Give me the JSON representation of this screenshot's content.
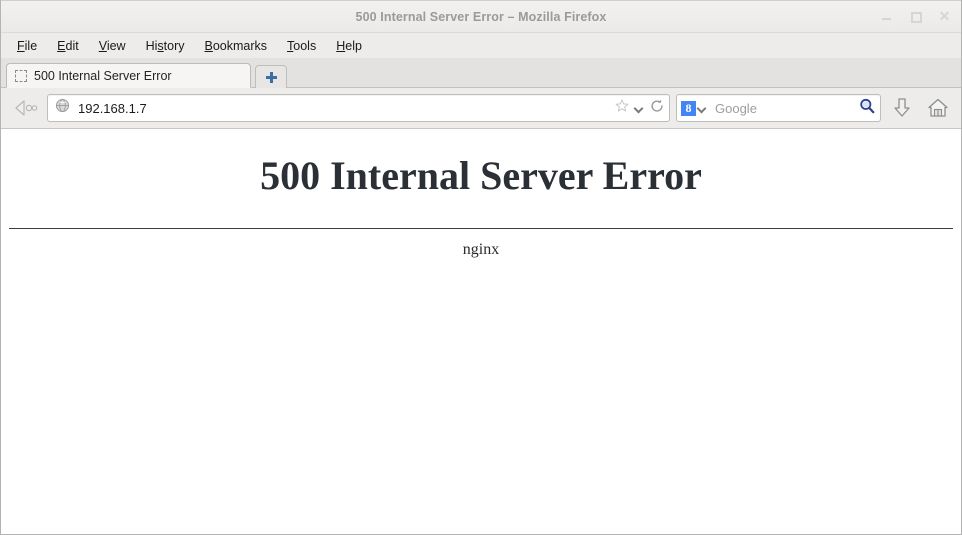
{
  "window": {
    "title": "500 Internal Server Error – Mozilla Firefox",
    "controls": {
      "minimize": "minimize",
      "maximize": "maximize",
      "close": "close"
    }
  },
  "menubar": {
    "items": [
      {
        "pre": "",
        "mnemonic": "F",
        "post": "ile"
      },
      {
        "pre": "",
        "mnemonic": "E",
        "post": "dit"
      },
      {
        "pre": "",
        "mnemonic": "V",
        "post": "iew"
      },
      {
        "pre": "Hi",
        "mnemonic": "s",
        "post": "tory"
      },
      {
        "pre": "",
        "mnemonic": "B",
        "post": "ookmarks"
      },
      {
        "pre": "",
        "mnemonic": "T",
        "post": "ools"
      },
      {
        "pre": "",
        "mnemonic": "H",
        "post": "elp"
      }
    ]
  },
  "tabs": {
    "active_tab_label": "500 Internal Server Error",
    "new_tab_icon": "plus-icon"
  },
  "toolbar": {
    "back_forward_icon": "back-forward-icon",
    "identity_icon": "globe-icon",
    "url_value": "192.168.1.7",
    "bookmark_icon": "star-icon",
    "bookmark_dropdown_icon": "chevron-down-icon",
    "reload_icon": "reload-icon",
    "search_engine_icon": "google-favicon",
    "search_engine_glyph": "8",
    "search_engine_dropdown_icon": "chevron-down-icon",
    "search_placeholder": "Google",
    "search_go_icon": "magnifier-icon",
    "downloads_icon": "download-arrow-icon",
    "home_icon": "home-icon"
  },
  "page": {
    "heading": "500 Internal Server Error",
    "server": "nginx"
  },
  "colors": {
    "accent_blue": "#3a6ea5",
    "google_blue": "#4285f4",
    "title_gray": "#9a9a9a",
    "heading_dark": "#2b3036",
    "chrome_bg": "#edecea",
    "tabstrip_bg": "#e4e2e0"
  }
}
